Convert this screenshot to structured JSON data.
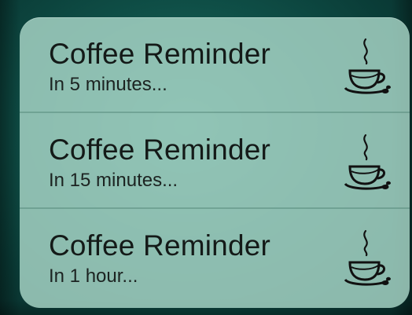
{
  "notifications": [
    {
      "title": "Coffee Reminder",
      "subtitle": "In 5 minutes...",
      "icon": "coffee-cup-icon"
    },
    {
      "title": "Coffee Reminder",
      "subtitle": "In 15 minutes...",
      "icon": "coffee-cup-icon"
    },
    {
      "title": "Coffee Reminder",
      "subtitle": "In 1 hour...",
      "icon": "coffee-cup-icon"
    }
  ],
  "colors": {
    "panel": "#aad7c8",
    "text": "#141a18",
    "background": "#0f4f47"
  }
}
